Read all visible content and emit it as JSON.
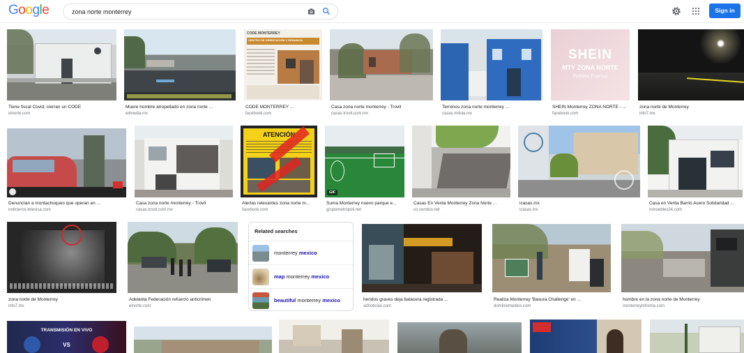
{
  "header": {
    "logo": [
      "G",
      "o",
      "o",
      "g",
      "l",
      "e"
    ],
    "logo_colors": [
      "#4285f4",
      "#ea4335",
      "#fbbc05",
      "#4285f4",
      "#34a853",
      "#ea4335"
    ],
    "search_value": "zona norte monterrey",
    "signin_label": "Sign in"
  },
  "results": [
    {
      "caption": "Tiene fiscal Covid; cierran un CODE",
      "source": "elnorte.com"
    },
    {
      "caption": "Muere hombre atropellado en zona norte ...",
      "source": "elimedia.mx"
    },
    {
      "caption": "CODE MONTERREY ...",
      "source": "facebook.com"
    },
    {
      "caption": "Casa zona norte monterrey - Trovit",
      "source": "casas.trovit.com.mx"
    },
    {
      "caption": "Terrenos zona norte monterrey ...",
      "source": "casas.mitula.mx"
    },
    {
      "caption": "SHEIN Monterrey ZONA NORTE - ...",
      "source": "facebook.com"
    },
    {
      "caption": "zona norte de Monterrey",
      "source": "info7.mx"
    },
    {
      "caption": "Denuncian a montachoques que operan en ...",
      "source": "noticieros.televisa.com"
    },
    {
      "caption": "Casa zona norte monterrey - Trovit",
      "source": "casas.trovit.com.mx"
    },
    {
      "caption": "Alertas relevantes zona norte m...",
      "source": "facebook.com"
    },
    {
      "caption": "Suma Monterrey nuevo parque e...",
      "source": "grupometropoli.net"
    },
    {
      "caption": "Casas En Venta Monterrey Zona Norte ...",
      "source": "co.vendoo.net"
    },
    {
      "caption": "icasas.mx",
      "source": "icasas.mx"
    },
    {
      "caption": "Casa en Venta Barrio Acero Solidaridad ...",
      "source": "inmuebles24.com"
    },
    {
      "caption": "zona norte de Monterrey",
      "source": "info7.mx"
    },
    {
      "caption": "Adelanta Federación refuerzo anticrimen",
      "source": "elnorte.com"
    },
    {
      "caption": "heridos graves deja balacera registrada ...",
      "source": "adnoticias.com"
    },
    {
      "caption": "Realiza Monterrey 'Basura Challenge' en ...",
      "source": "dominiomedios.com"
    },
    {
      "caption": "hombre en la zona norte de Monterrey",
      "source": "monterreyinforma.com"
    }
  ],
  "thumb_text": {
    "code_title": "CODE MONTERREY",
    "code_sub": "CENTRO DE ORIENTACIÓN Y DENUNCIA",
    "shein_big": "SHEIN",
    "shein_small": "MTY ZONA NORTE",
    "shein_script": "Pedidos Express",
    "atencion": "ATENCIÓN",
    "gif": "GIF",
    "transmision": "TRANSMISIÓN EN VIVO",
    "vs": "VS"
  },
  "related": {
    "title": "Related searches",
    "items": [
      {
        "bold": "",
        "normal": "monterrey ",
        "bold2": "mexico"
      },
      {
        "bold": "map ",
        "normal": "monterrey ",
        "bold2": "mexico"
      },
      {
        "bold": "beautiful ",
        "normal": "monterrey ",
        "bold2": "mexico"
      }
    ]
  }
}
